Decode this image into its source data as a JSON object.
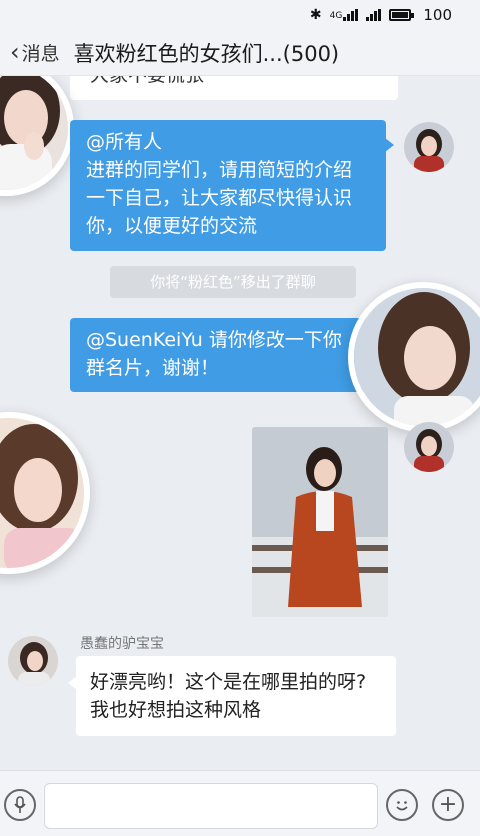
{
  "status_bar": {
    "icons": [
      "bluetooth-icon",
      "signal-4g-icon",
      "signal-icon",
      "battery-icon"
    ],
    "network_label": "4G",
    "battery": "100"
  },
  "header": {
    "back_label": "消息",
    "title": "喜欢粉红色的女孩们...(500)"
  },
  "messages": {
    "partial_top_text": "大家不要慌张",
    "announcement": {
      "line1": "@所有人",
      "line2": "进群的同学们，请用简短的介绍",
      "line3": "一下自己，让大家都尽快得认识",
      "line4": "你，以便更好的交流"
    },
    "system_notice": "你将“粉红色”移出了群聊",
    "mention": {
      "line1": "@SuenKeiYu 请你修改一下你",
      "line2": "群名片，谢谢！"
    },
    "sender_name": "愚蠢的驴宝宝",
    "reply": {
      "line1": "好漂亮哟！这个是在哪里拍的呀?",
      "line2": "我也好想拍这种风格"
    }
  },
  "input_bar": {
    "placeholder": ""
  },
  "colors": {
    "accent_bubble": "#3f9ce5",
    "background": "#eaedf2",
    "system_notice_bg": "#d7dade"
  }
}
